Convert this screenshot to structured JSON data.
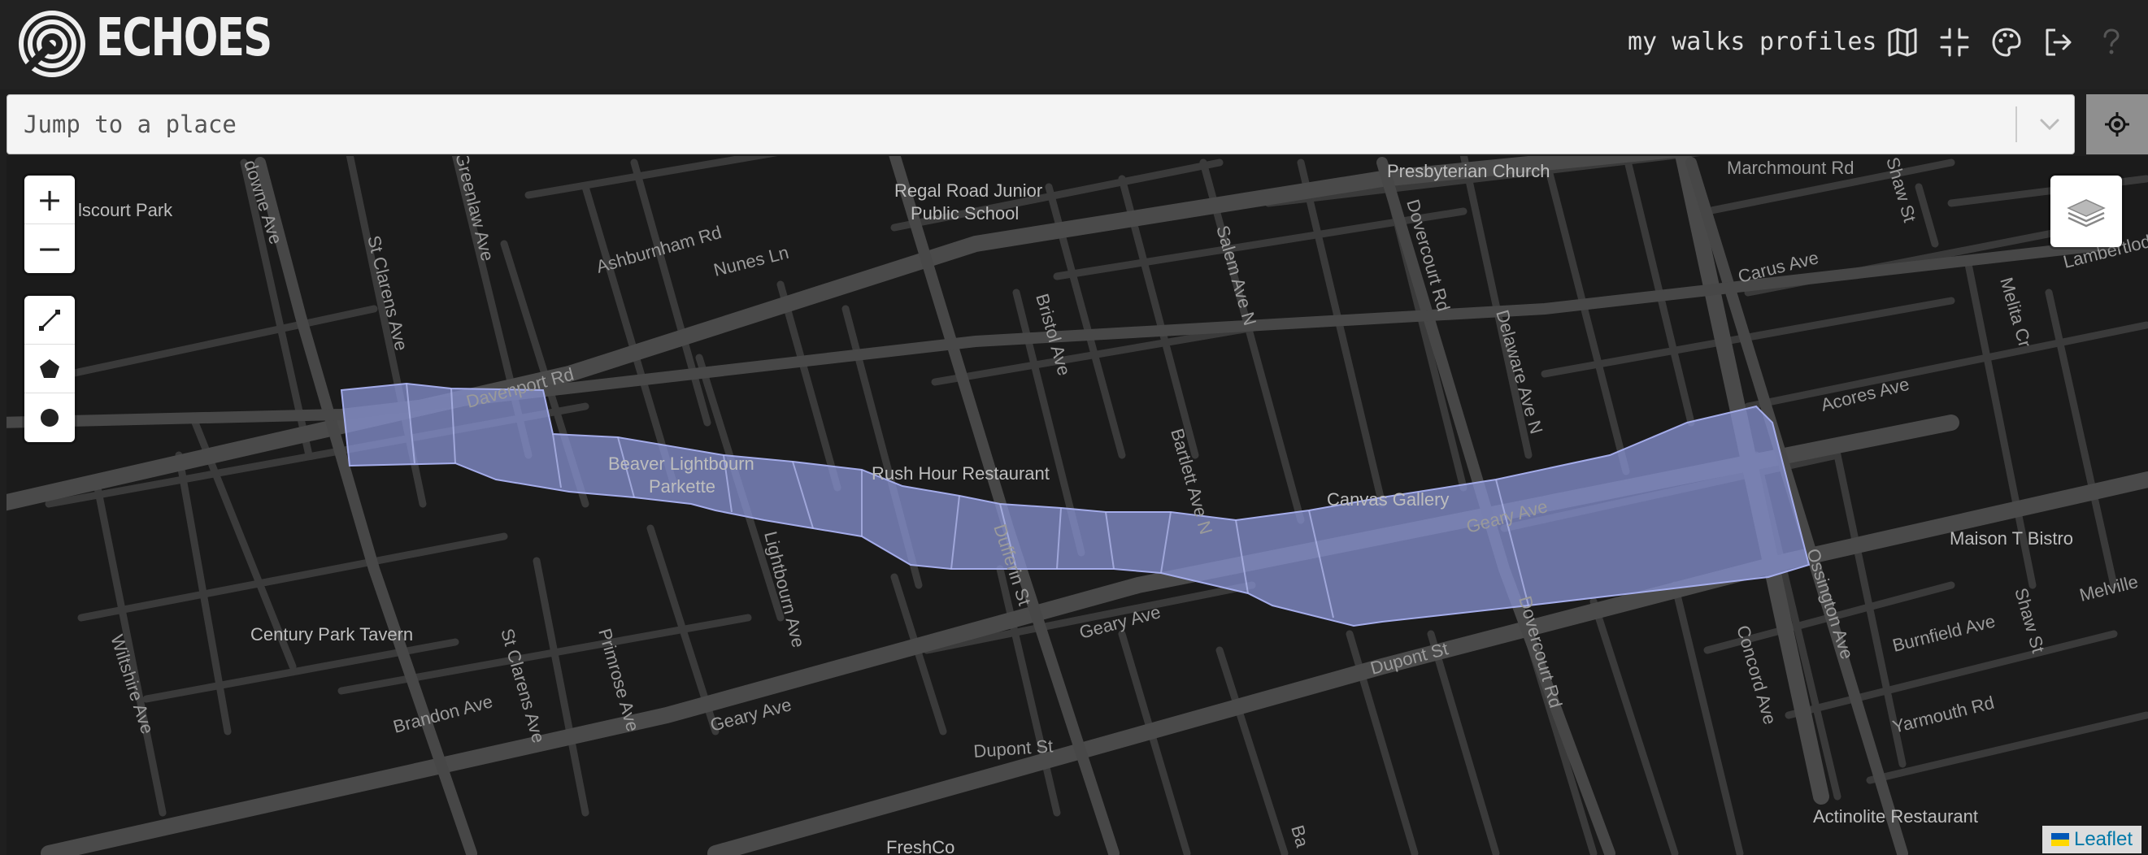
{
  "app": {
    "brand": "ECHOES",
    "nav": {
      "my_walks": "my walks",
      "profiles": "profiles"
    },
    "icons": [
      "map-icon",
      "shrink-icon",
      "palette-icon",
      "logout-icon",
      "help-icon"
    ]
  },
  "search": {
    "placeholder": "Jump to a place"
  },
  "map_controls": {
    "zoom_in": "+",
    "zoom_out": "−",
    "draw_tools": [
      "polyline-icon",
      "polygon-icon",
      "circle-icon"
    ],
    "layers": "layers-icon",
    "attribution": "Leaflet"
  },
  "colors": {
    "header_bg": "#222222",
    "map_bg": "#1b1b1b",
    "road": "#3d3d3d",
    "highlight": "#8b95d8"
  },
  "map_labels": {
    "places": {
      "iscourt": "lscourt Park",
      "regal1": "Regal Road Junior",
      "regal2": "Public School",
      "presby": "Presbyterian Church",
      "beaver1": "Beaver Lightbourn",
      "beaver2": "Parkette",
      "rush": "Rush Hour Restaurant",
      "canvas": "Canvas Gallery",
      "maison": "Maison T Bistro",
      "century": "Century Park Tavern",
      "actinolite": "Actinolite Restaurant",
      "fresh": "FreshCo"
    },
    "roads": {
      "lansdowne": "downe Ave",
      "stclarens1": "St Clarens Ave",
      "greenlaw": "Greenlaw Ave",
      "ashburnham": "Ashburnham Rd",
      "nunes": "Nunes Ln",
      "davenport": "Davenport Rd",
      "bristol": "Bristol Ave",
      "salem": "Salem Ave N",
      "dovercourt1": "Dovercourt Rd",
      "delaware": "Delaware Ave N",
      "marchmount": "Marchmount Rd",
      "shaw1": "Shaw St",
      "carus": "Carus Ave",
      "melita": "Melita Cr",
      "lambertlodge": "Lambertlod",
      "acores": "Acores Ave",
      "geary1": "Geary Ave",
      "bartlett": "Bartlett Ave N",
      "dufferin": "Dufferin St",
      "lightbourn": "Lightbourn Ave",
      "geary2": "Geary Ave",
      "dupont1": "Dupont St",
      "dovercourt2": "Dovercourt Rd",
      "concord": "Concord Ave",
      "ossington": "Ossington Ave",
      "burnfield": "Burnfield Ave",
      "shaw2": "Shaw St",
      "melville": "Melville",
      "yarmouth": "Yarmouth Rd",
      "wiltshire": "Wiltshire Ave",
      "brandon": "Brandon Ave",
      "stclarens2": "St Clarens Ave",
      "primrose": "Primrose Ave",
      "geary3": "Geary Ave",
      "dupont2": "Dupont St",
      "geary4": "Geary Ave",
      "bartlett2": "Ba"
    }
  }
}
